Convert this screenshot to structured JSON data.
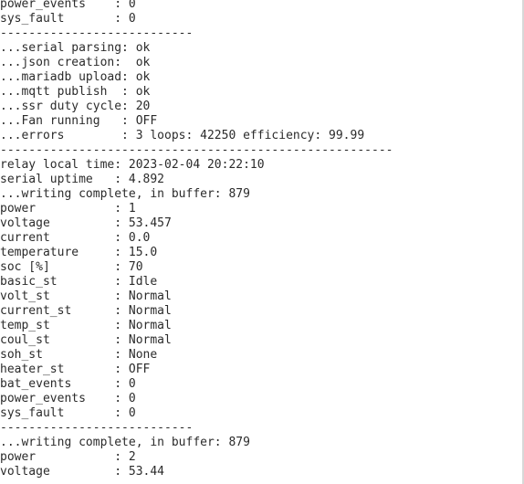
{
  "terminal": {
    "lines": [
      "power_events    : 0",
      "sys_fault       : 0",
      "---------------------------",
      "...serial parsing: ok",
      "...json creation:  ok",
      "...mariadb upload: ok",
      "...mqtt publish  : ok",
      "...ssr duty cycle: 20",
      "...Fan running   : OFF",
      "...errors        : 3 loops: 42250 efficiency: 99.99",
      "-------------------------------------------------------",
      "relay local time: 2023-02-04 20:22:10",
      "serial uptime   : 4.892",
      "...writing complete, in buffer: 879",
      "power           : 1",
      "voltage         : 53.457",
      "current         : 0.0",
      "temperature     : 15.0",
      "soc [%]         : 70",
      "basic_st        : Idle",
      "volt_st         : Normal",
      "current_st      : Normal",
      "temp_st         : Normal",
      "coul_st         : Normal",
      "soh_st          : None",
      "heater_st       : OFF",
      "bat_events      : 0",
      "power_events    : 0",
      "sys_fault       : 0",
      "---------------------------",
      "...writing complete, in buffer: 879",
      "power           : 2",
      "voltage         : 53.44"
    ]
  }
}
